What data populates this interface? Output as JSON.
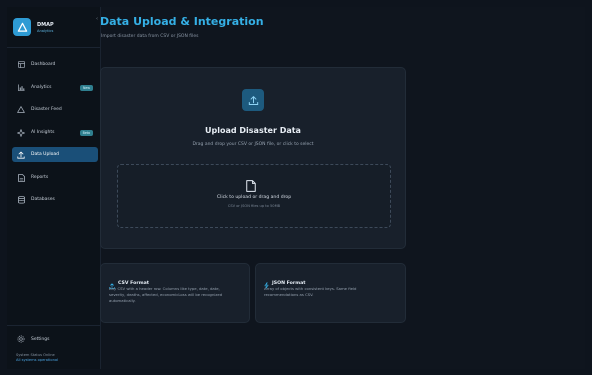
{
  "app": {
    "name": "DMAP",
    "subtitle": "Analytics",
    "collapse_glyph": "‹"
  },
  "sidebar": {
    "items": [
      {
        "label": "Dashboard",
        "icon": "dashboard-icon",
        "badge": ""
      },
      {
        "label": "Analytics",
        "icon": "chart-icon",
        "badge": "New"
      },
      {
        "label": "Disaster Feed",
        "icon": "warning-icon",
        "badge": ""
      },
      {
        "label": "AI Insights",
        "icon": "sparkle-icon",
        "badge": "Beta"
      },
      {
        "label": "Data Upload",
        "icon": "upload-icon",
        "badge": "",
        "active": true
      },
      {
        "label": "Reports",
        "icon": "document-icon",
        "badge": ""
      },
      {
        "label": "Databases",
        "icon": "database-icon",
        "badge": ""
      }
    ],
    "settings_label": "Settings",
    "status_title": "System Status Online",
    "status_sub": "All systems operational"
  },
  "header": {
    "title": "Data Upload & Integration",
    "subtitle": "Import disaster data from CSV or JSON files"
  },
  "upload": {
    "title": "Upload Disaster Data",
    "description": "Drag and drop your CSV or JSON file, or click to select",
    "dropzone_title": "Click to upload or drag and drop",
    "dropzone_sub": "CSV or JSON files up to 50MB"
  },
  "formats": {
    "csv": {
      "title": "CSV Format",
      "lines": [
        "Any CSV with a header row. Columns like type, date, date,",
        "severity, deaths, affected, economicLoss will be recognized",
        "automatically."
      ]
    },
    "json": {
      "title": "JSON Format",
      "lines": [
        "Array of objects with consistent keys. Same field",
        "recommendations as CSV."
      ]
    }
  },
  "colors": {
    "accent": "#35b0e6",
    "active_nav": "#1a4f78",
    "badge": "#2f7f8f",
    "card": "#18202b",
    "background": "#0f151e"
  }
}
